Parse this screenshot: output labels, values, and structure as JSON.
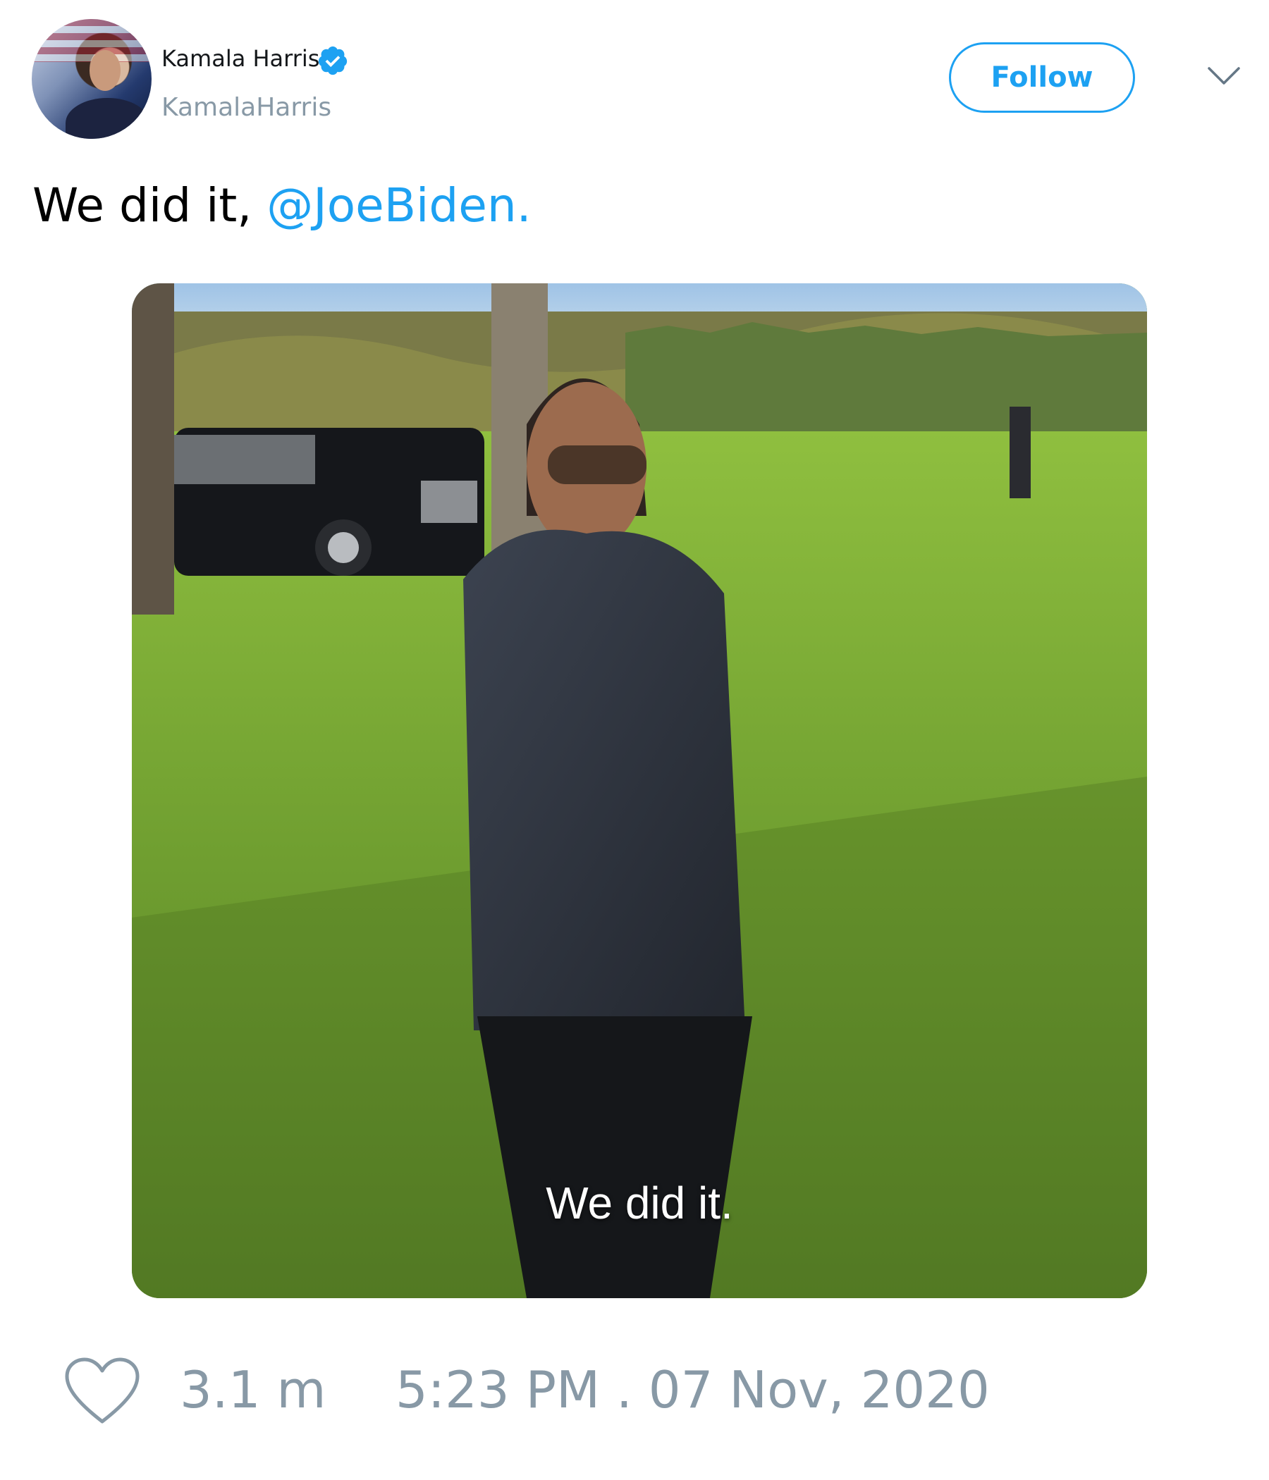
{
  "author": {
    "display_name": "Kamala Harris",
    "handle": "KamalaHarris",
    "verified": true
  },
  "follow_label": "Follow",
  "tweet": {
    "text": "We did it, ",
    "mention": "@JoeBiden."
  },
  "media": {
    "caption": "We did it."
  },
  "engagement": {
    "likes": "3.1 m"
  },
  "timestamp": "5:23 PM . 07 Nov, 2020",
  "icons": {
    "verified": "verified-badge-icon",
    "menu": "chevron-down-icon",
    "like": "heart-icon"
  },
  "colors": {
    "accent": "#1da1f2",
    "muted": "#8899a6",
    "text": "#000000"
  }
}
